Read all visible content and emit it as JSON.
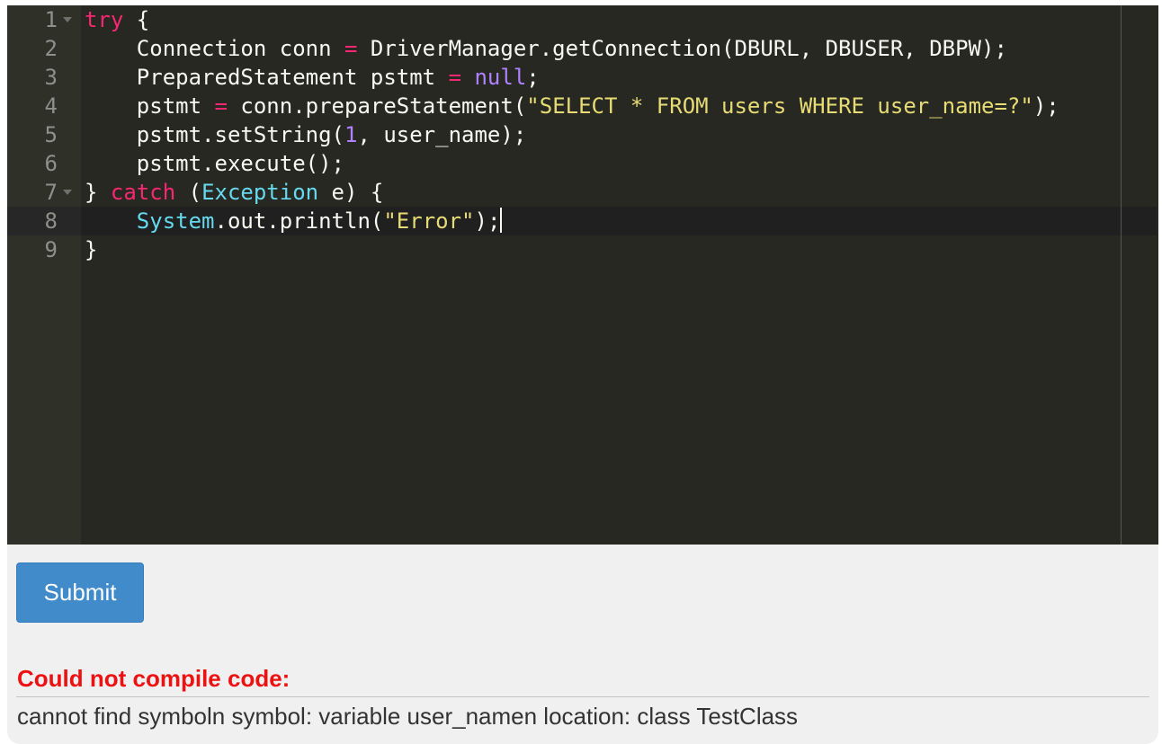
{
  "editor": {
    "active_line": 8,
    "lines": [
      {
        "number": "1",
        "foldable": true,
        "tokens": [
          [
            "kw",
            "try"
          ],
          [
            "",
            "​ {"
          ]
        ]
      },
      {
        "number": "2",
        "foldable": false,
        "tokens": [
          [
            "",
            "    Connection conn "
          ],
          [
            "kw",
            "="
          ],
          [
            "",
            " DriverManager.getConnection(DBURL, DBUSER, DBPW);"
          ]
        ]
      },
      {
        "number": "3",
        "foldable": false,
        "tokens": [
          [
            "",
            "    PreparedStatement pstmt "
          ],
          [
            "kw",
            "="
          ],
          [
            "",
            " "
          ],
          [
            "con",
            "null"
          ],
          [
            "",
            ";"
          ]
        ]
      },
      {
        "number": "4",
        "foldable": false,
        "tokens": [
          [
            "",
            "    pstmt "
          ],
          [
            "kw",
            "="
          ],
          [
            "",
            " conn.prepareStatement("
          ],
          [
            "str",
            "\"SELECT * FROM users WHERE user_name=?\""
          ],
          [
            "",
            ");"
          ]
        ]
      },
      {
        "number": "5",
        "foldable": false,
        "tokens": [
          [
            "",
            "    pstmt.setString("
          ],
          [
            "con",
            "1"
          ],
          [
            "",
            ", user_name);"
          ]
        ]
      },
      {
        "number": "6",
        "foldable": false,
        "tokens": [
          [
            "",
            "    pstmt.execute();"
          ]
        ]
      },
      {
        "number": "7",
        "foldable": true,
        "tokens": [
          [
            "",
            "} "
          ],
          [
            "kw",
            "catch"
          ],
          [
            "",
            " ("
          ],
          [
            "type",
            "Exception"
          ],
          [
            "",
            " e) {"
          ]
        ]
      },
      {
        "number": "8",
        "foldable": false,
        "tokens": [
          [
            "",
            "    "
          ],
          [
            "type",
            "System"
          ],
          [
            "",
            ".out.println("
          ],
          [
            "str",
            "\"Error\""
          ],
          [
            "",
            ");"
          ]
        ]
      },
      {
        "number": "9",
        "foldable": false,
        "tokens": [
          [
            "",
            "}"
          ]
        ]
      }
    ]
  },
  "submit_label": "Submit",
  "error": {
    "title": "Could not compile code:",
    "message": "cannot find symboln symbol: variable user_namen location: class TestClass"
  },
  "colors": {
    "editor_bg": "#272822",
    "keyword": "#f92672",
    "type": "#66d9ef",
    "constant": "#ae81ff",
    "string": "#e6db74",
    "button": "#428bca",
    "error_title": "#ee1111"
  }
}
